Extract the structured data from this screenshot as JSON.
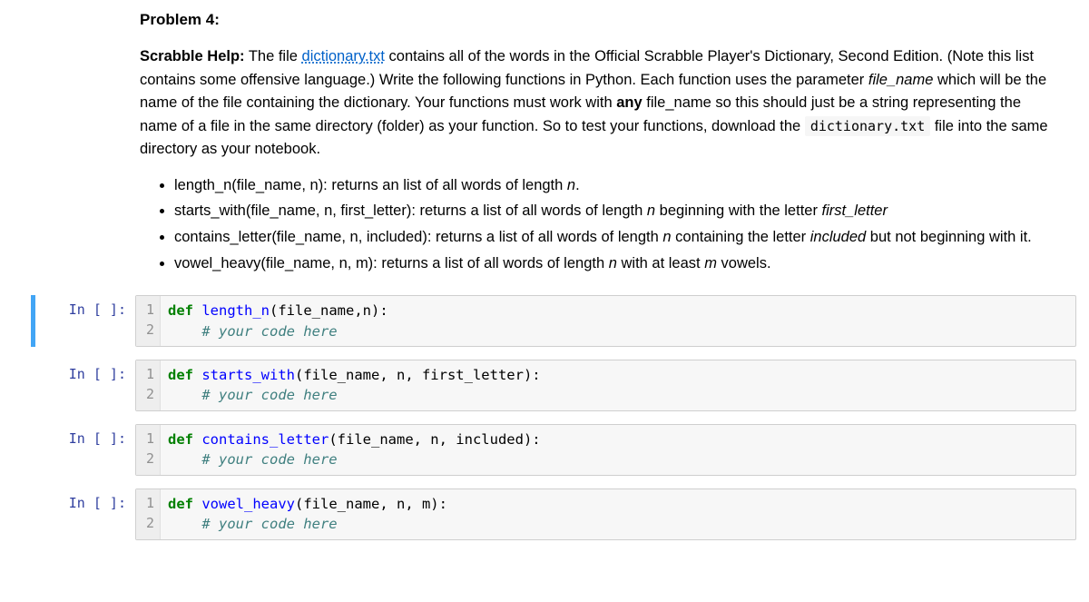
{
  "problem": {
    "title": "Problem 4:",
    "intro_strong": "Scrabble Help:",
    "intro_part1": " The file ",
    "link_text": "dictionary.txt",
    "intro_part2": " contains all of the words in the Official Scrabble Player's Dictionary, Second Edition. (Note this list contains some offensive language.) Write the following functions in Python. Each function uses the parameter ",
    "param_italic": "file_name",
    "intro_part3": " which will be the name of the file containing the dictionary. Your functions must work with ",
    "any_bold": "any",
    "intro_part4": " file_name so this should just be a string representing the name of a file in the same directory (folder) as your function. So to test your functions, download the ",
    "code_inline": "dictionary.txt",
    "intro_part5": " file into the same directory as your notebook.",
    "bullets": {
      "b1_a": "length_n(file_name, n): returns an list of all words of length ",
      "b1_i": "n",
      "b1_b": ".",
      "b2_a": "starts_with(file_name, n, first_letter): returns a list of all words of length ",
      "b2_i1": "n",
      "b2_b": " beginning with the letter ",
      "b2_i2": "first_letter",
      "b3_a": "contains_letter(file_name, n, included): returns a list of all words of length ",
      "b3_i1": "n",
      "b3_b": " containing the letter ",
      "b3_i2": "included",
      "b3_c": " but not beginning with it.",
      "b4_a": "vowel_heavy(file_name, n, m): returns a list of all words of length ",
      "b4_i1": "n",
      "b4_b": " with at least ",
      "b4_i2": "m",
      "b4_c": " vowels."
    }
  },
  "prompt_label": "In [ ]:",
  "cells": {
    "c1": {
      "def": "def",
      "name": "length_n",
      "args": "(file_name,n):",
      "comment": "# your code here"
    },
    "c2": {
      "def": "def",
      "name": "starts_with",
      "args": "(file_name, n, first_letter):",
      "comment": "# your code here"
    },
    "c3": {
      "def": "def",
      "name": "contains_letter",
      "args": "(file_name, n, included):",
      "comment": "# your code here"
    },
    "c4": {
      "def": "def",
      "name": "vowel_heavy",
      "args": "(file_name, n, m):",
      "comment": "# your code here"
    }
  },
  "line1": "1",
  "line2": "2"
}
